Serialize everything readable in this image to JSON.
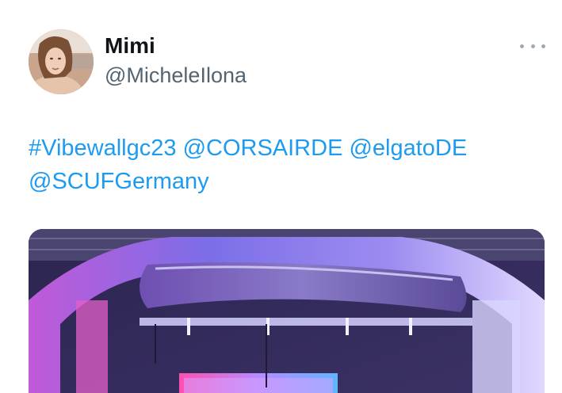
{
  "tweet": {
    "display_name": "Mimi",
    "handle": "@MicheleIlona",
    "more_icon": "more-horizontal-icon",
    "text_line1": [
      "#Vibewallgc23",
      "@CORSAIRDE",
      "@elgatoDE"
    ],
    "text_line2": [
      "@SCUFGermany"
    ],
    "colors": {
      "link": "#1d9bf0",
      "name": "#0f1419",
      "handle": "#536471"
    }
  }
}
